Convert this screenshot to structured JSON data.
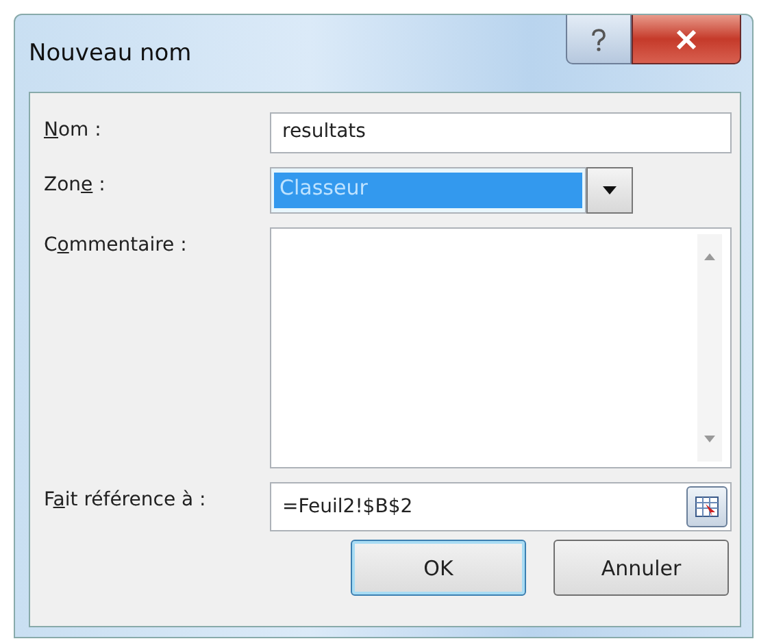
{
  "window": {
    "title": "Nouveau nom"
  },
  "fields": [
    {
      "kind": "text",
      "label": [
        {
          "text": "N",
          "underlined": true
        },
        {
          "text": "om :",
          "underlined": false
        }
      ],
      "value": "resultats"
    },
    {
      "kind": "select",
      "label": [
        {
          "text": "Zon",
          "underlined": false
        },
        {
          "text": "e",
          "underlined": true
        },
        {
          "text": " :",
          "underlined": false
        }
      ],
      "value": "Classeur",
      "selected": true
    },
    {
      "kind": "textarea",
      "label": [
        {
          "text": "C",
          "underlined": false
        },
        {
          "text": "o",
          "underlined": true
        },
        {
          "text": "mmentaire :",
          "underlined": false
        }
      ]
    },
    {
      "kind": "reference",
      "label": [
        {
          "text": "F",
          "underlined": false
        },
        {
          "text": "a",
          "underlined": true
        },
        {
          "text": "it référence à :",
          "underlined": false
        }
      ],
      "value": "=Feuil2!$B$2"
    }
  ],
  "buttons": [
    {
      "label": "OK",
      "default": true
    },
    {
      "label": "Annuler",
      "default": false
    }
  ]
}
